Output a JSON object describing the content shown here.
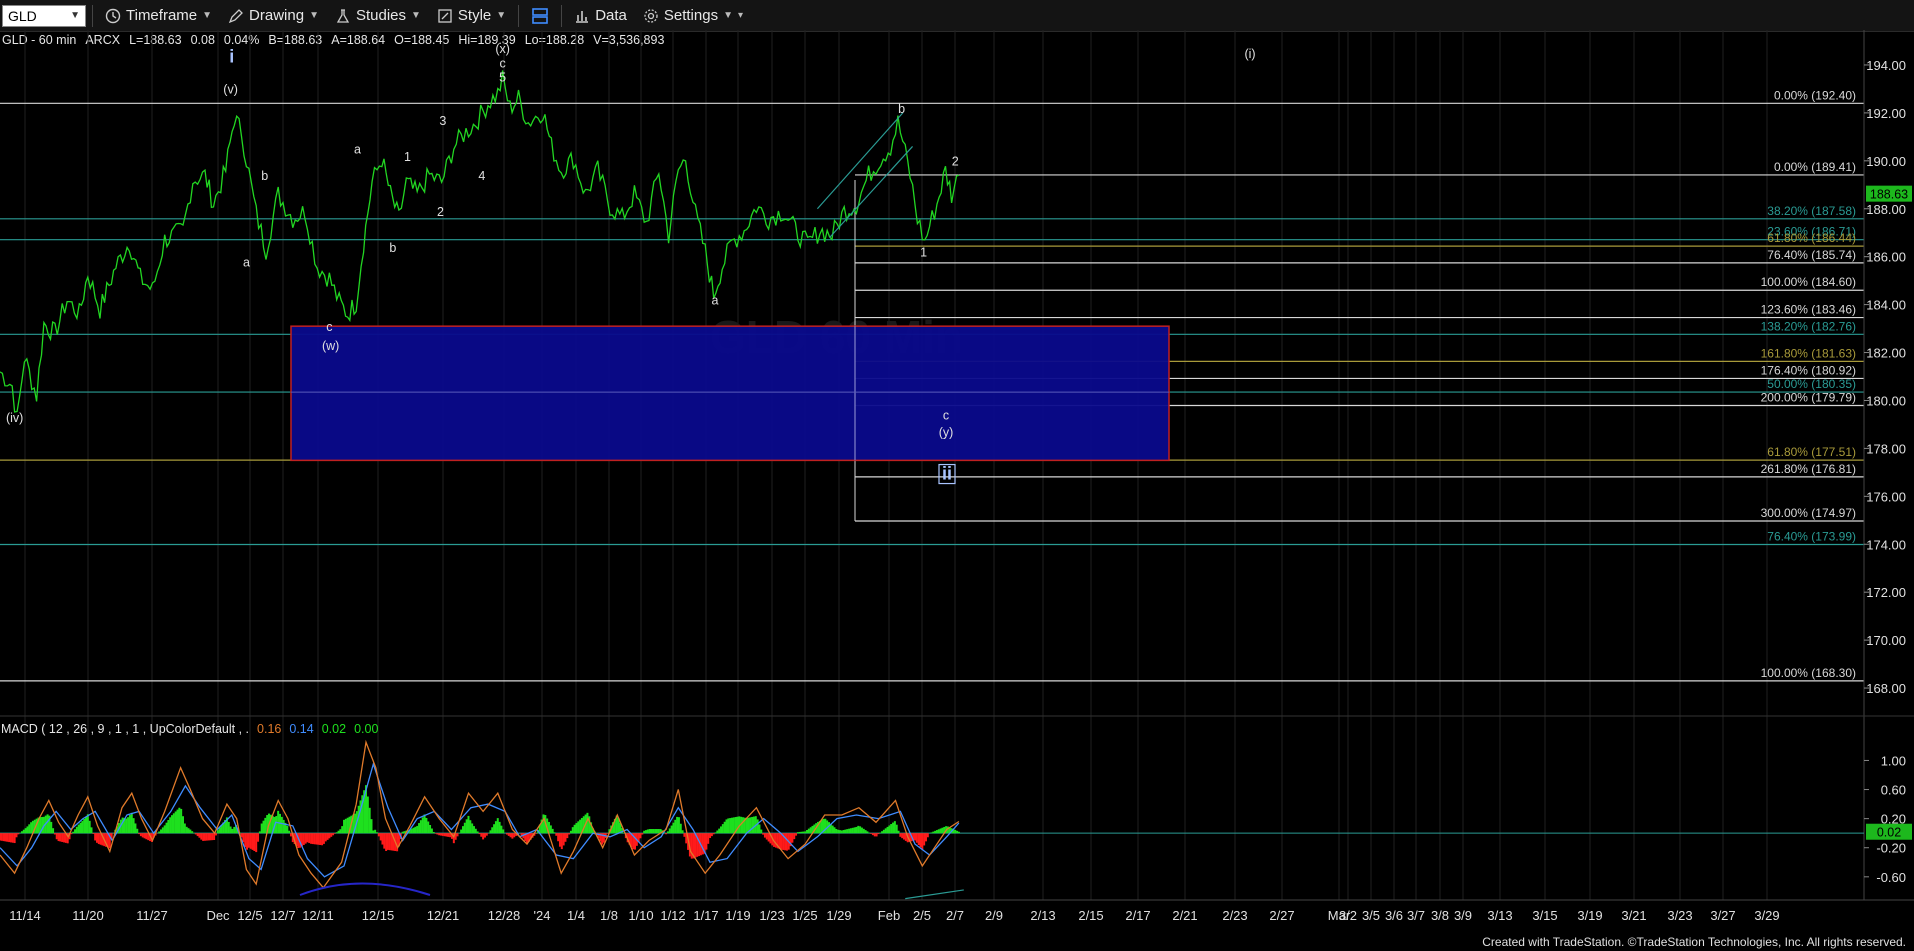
{
  "toolbar": {
    "symbol": "GLD",
    "timeframe_label": "Timeframe",
    "drawing_label": "Drawing",
    "studies_label": "Studies",
    "style_label": "Style",
    "data_label": "Data",
    "settings_label": "Settings"
  },
  "quote": {
    "title": "GLD - 60 min",
    "exchange": "ARCX",
    "last": "L=188.63",
    "change": "0.08",
    "pct": "0.04%",
    "bid": "B=188.63",
    "ask": "A=188.64",
    "open": "O=188.45",
    "high": "Hi=189.39",
    "low": "Lo=188.28",
    "volume": "V=3,536,893"
  },
  "watermark": "GLD 60 Min",
  "macd_title": {
    "label": "MACD ( 12 , 26 , 9 , 1 , 1 , UpColorDefault , .",
    "v1": "0.16",
    "v2": "0.14",
    "v3": "0.02",
    "v4": "0.00"
  },
  "footer": "Created with TradeStation. ©TradeStation Technologies, Inc. All rights reserved.",
  "colors": {
    "price": "#22d622",
    "macd_line": "#e07a2a",
    "signal_line": "#3f8cff",
    "hist_up": "#1ee01e",
    "hist_down": "#ff1a1a",
    "box_fill": "#0a0a8c",
    "box_border": "#c02020",
    "fib_teal": "#2a9b94",
    "fib_white": "#d8d8d8",
    "fib_olive": "#a89a3a"
  },
  "chart_data": {
    "type": "line",
    "symbol": "GLD",
    "interval": "60 min",
    "ylim": [
      167,
      195
    ],
    "y_ticks": [
      "194.00",
      "192.00",
      "190.00",
      "188.00",
      "186.00",
      "184.00",
      "182.00",
      "180.00",
      "178.00",
      "176.00",
      "174.00",
      "172.00",
      "170.00",
      "168.00"
    ],
    "last_price": "188.63",
    "x_ticks": [
      "11/14",
      "11/20",
      "11/27",
      "Dec",
      "12/5",
      "12/7",
      "12/11",
      "12/15",
      "12/21",
      "12/28",
      "'24",
      "1/4",
      "1/8",
      "1/10",
      "1/12",
      "1/17",
      "1/19",
      "1/23",
      "1/25",
      "1/29",
      "Feb",
      "2/5",
      "2/7",
      "2/9",
      "2/13",
      "2/15",
      "2/17",
      "2/21",
      "2/23",
      "2/27",
      "Mar",
      "3/2",
      "3/5",
      "3/6",
      "3/7",
      "3/8",
      "3/9",
      "3/13",
      "3/15",
      "3/19",
      "3/21",
      "3/23",
      "3/27",
      "3/29"
    ],
    "price_series": [
      [
        0,
        181.2
      ],
      [
        10,
        180.6
      ],
      [
        14,
        179.2
      ],
      [
        20,
        181.8
      ],
      [
        30,
        180.2
      ],
      [
        36,
        183.2
      ],
      [
        45,
        182.8
      ],
      [
        55,
        184.2
      ],
      [
        65,
        183.6
      ],
      [
        72,
        185.3
      ],
      [
        82,
        183.8
      ],
      [
        95,
        185.6
      ],
      [
        106,
        186.6
      ],
      [
        115,
        185.1
      ],
      [
        125,
        184.6
      ],
      [
        135,
        186.7
      ],
      [
        150,
        187.1
      ],
      [
        158,
        189.2
      ],
      [
        168,
        189.4
      ],
      [
        175,
        188.2
      ],
      [
        185,
        189.6
      ],
      [
        192,
        191.8
      ],
      [
        198,
        191.2
      ],
      [
        210,
        187.8
      ],
      [
        218,
        186.3
      ],
      [
        228,
        188.6
      ],
      [
        240,
        187.6
      ],
      [
        250,
        187.9
      ],
      [
        260,
        185.6
      ],
      [
        270,
        185.1
      ],
      [
        278,
        184.1
      ],
      [
        285,
        183.6
      ],
      [
        292,
        184.1
      ],
      [
        298,
        186.6
      ],
      [
        305,
        189.1
      ],
      [
        313,
        190.1
      ],
      [
        320,
        188.6
      ],
      [
        327,
        187.6
      ],
      [
        333,
        189.1
      ],
      [
        342,
        188.6
      ],
      [
        352,
        189.4
      ],
      [
        362,
        189.1
      ],
      [
        372,
        190.6
      ],
      [
        380,
        191.1
      ],
      [
        390,
        191.6
      ],
      [
        400,
        192.4
      ],
      [
        408,
        192.8
      ],
      [
        412,
        193.4
      ],
      [
        418,
        192.2
      ],
      [
        425,
        192.6
      ],
      [
        433,
        191.6
      ],
      [
        445,
        192.1
      ],
      [
        452,
        190.6
      ],
      [
        460,
        189.6
      ],
      [
        470,
        190.1
      ],
      [
        480,
        188.6
      ],
      [
        490,
        189.6
      ],
      [
        500,
        188.1
      ],
      [
        510,
        187.6
      ],
      [
        520,
        188.6
      ],
      [
        530,
        187.4
      ],
      [
        540,
        189.6
      ],
      [
        548,
        186.9
      ],
      [
        556,
        189.6
      ],
      [
        562,
        190.1
      ],
      [
        570,
        187.8
      ],
      [
        578,
        186.2
      ],
      [
        585,
        184.4
      ],
      [
        592,
        185.6
      ],
      [
        600,
        186.6
      ],
      [
        610,
        187.1
      ],
      [
        620,
        188.1
      ],
      [
        630,
        187.6
      ],
      [
        642,
        187.9
      ],
      [
        652,
        187.1
      ],
      [
        662,
        186.5
      ],
      [
        672,
        187.1
      ],
      [
        682,
        186.9
      ],
      [
        692,
        187.9
      ],
      [
        702,
        188.2
      ],
      [
        712,
        189.4
      ],
      [
        722,
        190.1
      ],
      [
        730,
        190.6
      ],
      [
        736,
        191.6
      ],
      [
        740,
        190.8
      ],
      [
        746,
        189.4
      ],
      [
        752,
        187.6
      ],
      [
        758,
        186.6
      ],
      [
        762,
        187.3
      ],
      [
        768,
        188.2
      ],
      [
        775,
        189.6
      ],
      [
        780,
        188.6
      ],
      [
        786,
        189.4
      ]
    ],
    "fib_levels": [
      {
        "label": "0.00% (192.40)",
        "value": 192.4,
        "color": "white"
      },
      {
        "label": "0.00% (189.41)",
        "value": 189.41,
        "color": "white"
      },
      {
        "label": "38.20% (187.58)",
        "value": 187.58,
        "color": "teal"
      },
      {
        "label": "23.60% (186.71)",
        "value": 186.71,
        "color": "teal"
      },
      {
        "label": "61.80% (186.44)",
        "value": 186.44,
        "color": "olive"
      },
      {
        "label": "76.40% (185.74)",
        "value": 185.74,
        "color": "white"
      },
      {
        "label": "100.00% (184.60)",
        "value": 184.6,
        "color": "white"
      },
      {
        "label": "123.60% (183.46)",
        "value": 183.46,
        "color": "white"
      },
      {
        "label": "138.20% (182.76)",
        "value": 182.76,
        "color": "teal"
      },
      {
        "label": "161.80% (181.63)",
        "value": 181.63,
        "color": "olive"
      },
      {
        "label": "176.40% (180.92)",
        "value": 180.92,
        "color": "white"
      },
      {
        "label": "50.00% (180.35)",
        "value": 180.35,
        "color": "teal"
      },
      {
        "label": "200.00% (179.79)",
        "value": 179.79,
        "color": "white"
      },
      {
        "label": "61.80% (177.51)",
        "value": 177.51,
        "color": "olive"
      },
      {
        "label": "261.80% (176.81)",
        "value": 176.81,
        "color": "white"
      },
      {
        "label": "300.00% (174.97)",
        "value": 174.97,
        "color": "white"
      },
      {
        "label": "76.40% (173.99)",
        "value": 173.99,
        "color": "teal"
      },
      {
        "label": "100.00% (168.30)",
        "value": 168.3,
        "color": "white"
      }
    ],
    "target_box": {
      "y_top": 183.1,
      "y_bottom": 177.5
    },
    "wave_labels": [
      {
        "text": "i",
        "x": 190,
        "y": 194.1
      },
      {
        "text": "(v)",
        "x": 189,
        "y": 192.8
      },
      {
        "text": "(x)",
        "x": 412,
        "y": 194.5
      },
      {
        "text": "c",
        "x": 412,
        "y": 193.9
      },
      {
        "text": "5",
        "x": 412,
        "y": 193.3
      },
      {
        "text": "3",
        "x": 363,
        "y": 191.5
      },
      {
        "text": "1",
        "x": 334,
        "y": 190.0
      },
      {
        "text": "4",
        "x": 395,
        "y": 189.2
      },
      {
        "text": "2",
        "x": 361,
        "y": 187.7
      },
      {
        "text": "a",
        "x": 293,
        "y": 190.3
      },
      {
        "text": "b",
        "x": 217,
        "y": 189.2
      },
      {
        "text": "a",
        "x": 202,
        "y": 185.6
      },
      {
        "text": "b",
        "x": 322,
        "y": 186.2
      },
      {
        "text": "c",
        "x": 270,
        "y": 182.9
      },
      {
        "text": "(w)",
        "x": 271,
        "y": 182.1
      },
      {
        "text": "(iv)",
        "x": 12,
        "y": 179.1
      },
      {
        "text": "b",
        "x": 739,
        "y": 192.0
      },
      {
        "text": "2",
        "x": 783,
        "y": 189.8
      },
      {
        "text": "1",
        "x": 757,
        "y": 186.0
      },
      {
        "text": "a",
        "x": 586,
        "y": 184.0
      },
      {
        "text": "c",
        "x": 946,
        "y": 179.2
      },
      {
        "text": "(y)",
        "x": 946,
        "y": 178.5
      },
      {
        "text": "ii",
        "x": 947,
        "y": 176.7
      },
      {
        "text": "(i)",
        "x": 1250,
        "y": 194.3
      }
    ],
    "macd": {
      "ylim": [
        -0.85,
        1.35
      ],
      "y_ticks": [
        "1.00",
        "0.60",
        "0.20",
        "-0.20",
        "-0.60"
      ],
      "last_value": "0.02",
      "macd_line": [
        [
          0,
          -0.3
        ],
        [
          12,
          -0.55
        ],
        [
          22,
          -0.2
        ],
        [
          32,
          0.2
        ],
        [
          40,
          0.45
        ],
        [
          48,
          0.15
        ],
        [
          56,
          -0.05
        ],
        [
          64,
          0.25
        ],
        [
          72,
          0.5
        ],
        [
          80,
          0.1
        ],
        [
          90,
          -0.25
        ],
        [
          100,
          0.35
        ],
        [
          108,
          0.55
        ],
        [
          116,
          0.2
        ],
        [
          125,
          -0.1
        ],
        [
          135,
          0.3
        ],
        [
          148,
          0.9
        ],
        [
          156,
          0.6
        ],
        [
          166,
          0.2
        ],
        [
          176,
          0.0
        ],
        [
          186,
          0.4
        ],
        [
          194,
          0.2
        ],
        [
          202,
          -0.5
        ],
        [
          210,
          -0.7
        ],
        [
          220,
          0.1
        ],
        [
          228,
          0.45
        ],
        [
          236,
          0.2
        ],
        [
          245,
          -0.3
        ],
        [
          255,
          -0.55
        ],
        [
          265,
          -0.75
        ],
        [
          280,
          -0.4
        ],
        [
          292,
          0.4
        ],
        [
          300,
          1.25
        ],
        [
          308,
          0.9
        ],
        [
          316,
          0.2
        ],
        [
          326,
          -0.2
        ],
        [
          336,
          0.1
        ],
        [
          348,
          0.5
        ],
        [
          360,
          0.2
        ],
        [
          372,
          -0.05
        ],
        [
          384,
          0.55
        ],
        [
          396,
          0.3
        ],
        [
          408,
          0.55
        ],
        [
          420,
          0.05
        ],
        [
          432,
          -0.15
        ],
        [
          446,
          0.2
        ],
        [
          460,
          -0.55
        ],
        [
          470,
          -0.25
        ],
        [
          482,
          0.2
        ],
        [
          494,
          -0.2
        ],
        [
          506,
          0.25
        ],
        [
          520,
          -0.3
        ],
        [
          532,
          -0.1
        ],
        [
          546,
          0.05
        ],
        [
          556,
          0.6
        ],
        [
          566,
          -0.25
        ],
        [
          578,
          -0.55
        ],
        [
          590,
          -0.3
        ],
        [
          606,
          0.1
        ],
        [
          620,
          0.35
        ],
        [
          634,
          -0.1
        ],
        [
          646,
          -0.35
        ],
        [
          660,
          -0.15
        ],
        [
          676,
          0.25
        ],
        [
          690,
          0.25
        ],
        [
          704,
          0.35
        ],
        [
          718,
          0.15
        ],
        [
          734,
          0.45
        ],
        [
          744,
          -0.05
        ],
        [
          756,
          -0.45
        ],
        [
          766,
          -0.2
        ],
        [
          776,
          0.05
        ],
        [
          786,
          0.16
        ]
      ],
      "signal_line": [
        [
          0,
          -0.2
        ],
        [
          14,
          -0.45
        ],
        [
          26,
          -0.2
        ],
        [
          36,
          0.1
        ],
        [
          46,
          0.3
        ],
        [
          58,
          0.05
        ],
        [
          68,
          0.2
        ],
        [
          78,
          0.3
        ],
        [
          92,
          -0.1
        ],
        [
          104,
          0.25
        ],
        [
          114,
          0.3
        ],
        [
          126,
          0.0
        ],
        [
          140,
          0.3
        ],
        [
          152,
          0.65
        ],
        [
          164,
          0.35
        ],
        [
          178,
          0.05
        ],
        [
          190,
          0.25
        ],
        [
          204,
          -0.35
        ],
        [
          214,
          -0.5
        ],
        [
          226,
          0.15
        ],
        [
          240,
          0.1
        ],
        [
          252,
          -0.35
        ],
        [
          266,
          -0.6
        ],
        [
          282,
          -0.45
        ],
        [
          296,
          0.35
        ],
        [
          306,
          0.95
        ],
        [
          318,
          0.35
        ],
        [
          330,
          -0.1
        ],
        [
          342,
          0.2
        ],
        [
          356,
          0.3
        ],
        [
          370,
          0.05
        ],
        [
          386,
          0.35
        ],
        [
          400,
          0.4
        ],
        [
          414,
          0.3
        ],
        [
          426,
          -0.05
        ],
        [
          440,
          0.05
        ],
        [
          456,
          -0.3
        ],
        [
          470,
          -0.35
        ],
        [
          486,
          0.0
        ],
        [
          500,
          -0.05
        ],
        [
          514,
          0.05
        ],
        [
          528,
          -0.2
        ],
        [
          542,
          -0.05
        ],
        [
          556,
          0.35
        ],
        [
          568,
          0.05
        ],
        [
          582,
          -0.4
        ],
        [
          596,
          -0.35
        ],
        [
          612,
          0.0
        ],
        [
          626,
          0.2
        ],
        [
          640,
          0.0
        ],
        [
          654,
          -0.25
        ],
        [
          670,
          -0.05
        ],
        [
          686,
          0.2
        ],
        [
          702,
          0.25
        ],
        [
          720,
          0.2
        ],
        [
          738,
          0.3
        ],
        [
          750,
          -0.15
        ],
        [
          762,
          -0.3
        ],
        [
          776,
          -0.05
        ],
        [
          786,
          0.14
        ]
      ]
    }
  }
}
